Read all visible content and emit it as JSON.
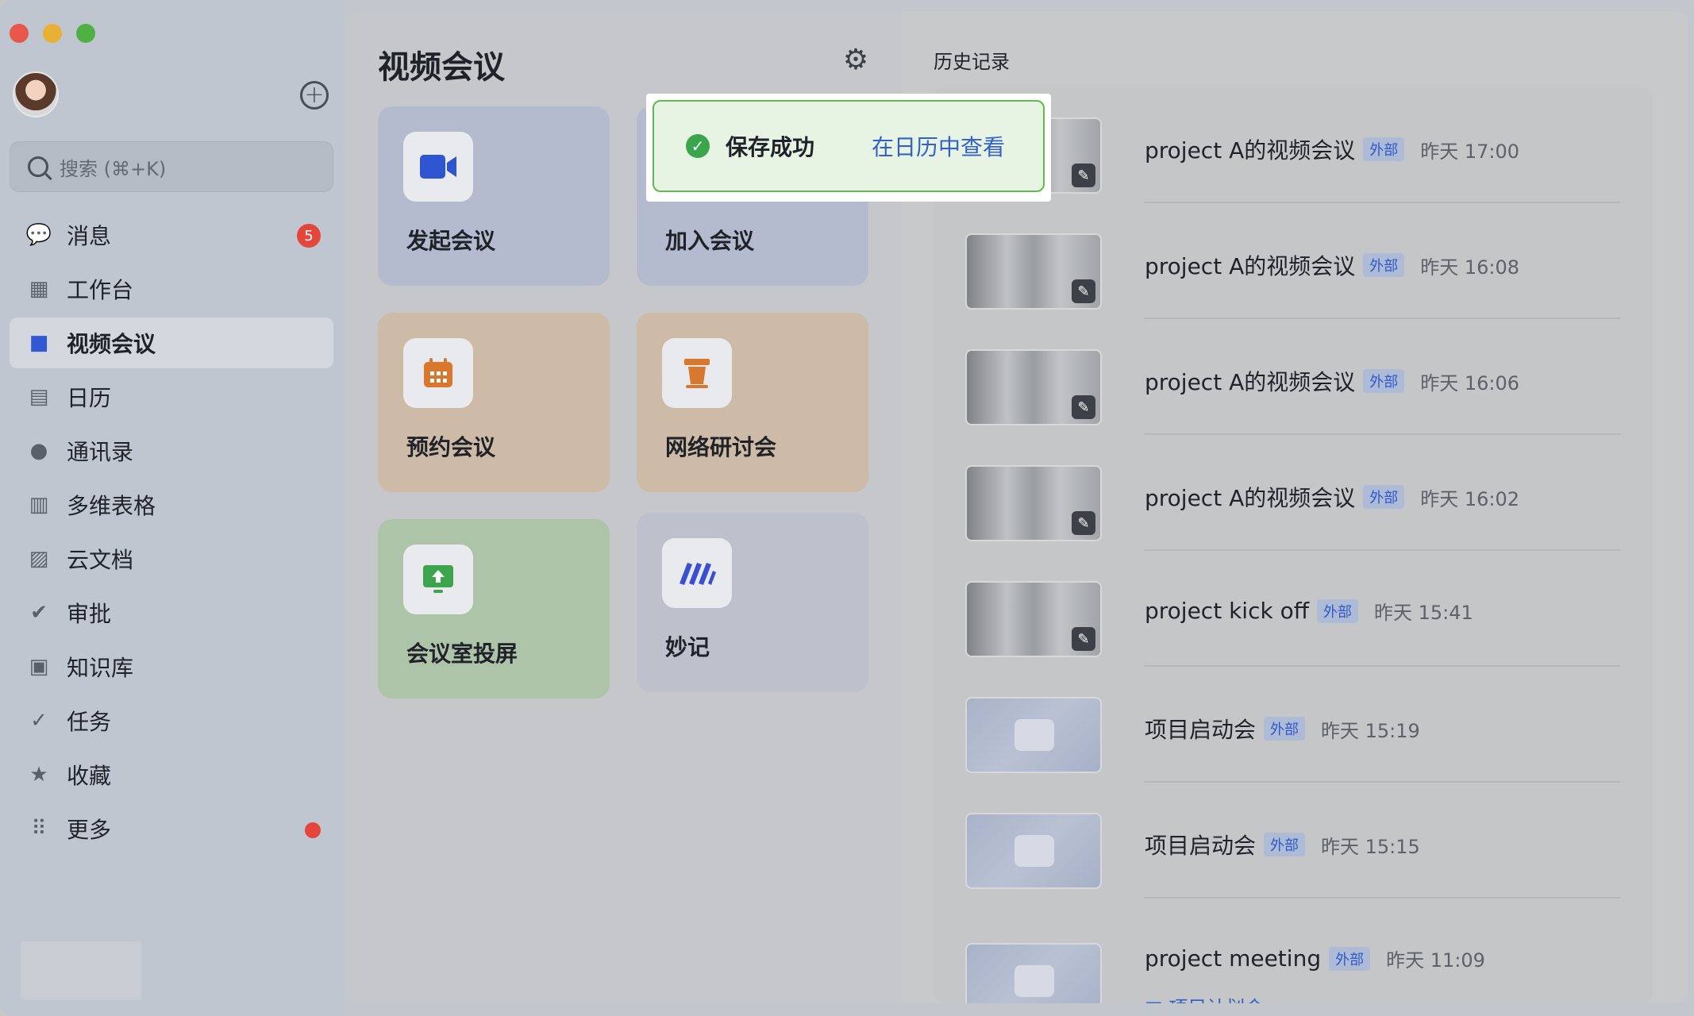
{
  "sidebar": {
    "search_placeholder": "搜索 (⌘+K)",
    "items": [
      {
        "label": "消息",
        "icon": "chat-icon",
        "badge": "5"
      },
      {
        "label": "工作台",
        "icon": "grid-icon"
      },
      {
        "label": "视频会议",
        "icon": "video-camera-icon",
        "active": true
      },
      {
        "label": "日历",
        "icon": "calendar-icon"
      },
      {
        "label": "通讯录",
        "icon": "contacts-icon"
      },
      {
        "label": "多维表格",
        "icon": "table-icon"
      },
      {
        "label": "云文档",
        "icon": "document-icon"
      },
      {
        "label": "审批",
        "icon": "approval-icon"
      },
      {
        "label": "知识库",
        "icon": "knowledge-base-icon"
      },
      {
        "label": "任务",
        "icon": "task-check-icon"
      },
      {
        "label": "收藏",
        "icon": "star-icon"
      },
      {
        "label": "更多",
        "icon": "more-dots-icon",
        "dot": true
      }
    ]
  },
  "main": {
    "title": "视频会议",
    "cards": {
      "start": "发起会议",
      "join": "加入会议",
      "book": "预约会议",
      "webinar": "网络研讨会",
      "room": "会议室投屏",
      "minutes": "妙记"
    }
  },
  "history": {
    "title": "历史记录",
    "rows": [
      {
        "title": "project A的视频会议",
        "tag": "外部",
        "time": "昨天 17:00",
        "thumb": "recording"
      },
      {
        "title": "project A的视频会议",
        "tag": "外部",
        "time": "昨天 16:08",
        "thumb": "recording"
      },
      {
        "title": "project A的视频会议",
        "tag": "外部",
        "time": "昨天 16:06",
        "thumb": "recording"
      },
      {
        "title": "project A的视频会议",
        "tag": "外部",
        "time": "昨天 16:02",
        "thumb": "recording"
      },
      {
        "title": "project kick off",
        "tag": "外部",
        "time": "昨天 15:41",
        "thumb": "recording"
      },
      {
        "title": "项目启动会",
        "tag": "外部",
        "time": "昨天 15:19",
        "thumb": "plain"
      },
      {
        "title": "项目启动会",
        "tag": "外部",
        "time": "昨天 15:15",
        "thumb": "plain"
      },
      {
        "title": "project meeting",
        "tag": "外部",
        "time": "昨天 11:09",
        "thumb": "plain",
        "link": "项目计划会"
      }
    ]
  },
  "toast": {
    "message": "保存成功",
    "link": "在日历中查看"
  },
  "colors": {
    "accent": "#3460c9",
    "success": "#3aa54a",
    "badge": "#e4463b"
  }
}
